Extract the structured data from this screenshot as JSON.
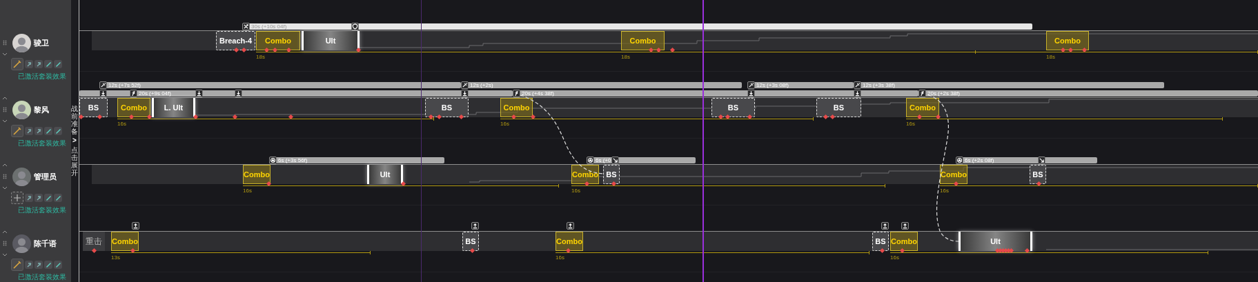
{
  "side_labels": [
    {
      "kind": "label",
      "text": "战前准备"
    },
    {
      "kind": "toggle",
      "text": ">"
    },
    {
      "kind": "label",
      "text": "点击展开"
    }
  ],
  "operators": [
    {
      "name": "骏卫",
      "can_move_up": false,
      "weapon_equipped": true,
      "set_bonus": "已激活套装效果",
      "buffs": [
        {
          "kind": "swords",
          "text": "30s (+10s 04f)",
          "color": "#e6e6e6"
        },
        {
          "kind": "shield"
        }
      ],
      "skills": [
        {
          "kind": "bs",
          "label": "Breach-4"
        },
        {
          "kind": "combo",
          "label": "Combo"
        },
        {
          "kind": "ult",
          "label": "Ult"
        },
        {
          "kind": "combo",
          "label": "Combo"
        },
        {
          "kind": "combo",
          "label": "Combo"
        }
      ],
      "cooldowns": [
        {
          "label": "18s"
        },
        {
          "label": "18s"
        },
        {
          "label": "18s"
        }
      ]
    },
    {
      "name": "黎风",
      "can_move_up": true,
      "weapon_equipped": true,
      "set_bonus": "已激活套装效果",
      "buffs": [
        {
          "kind": "burst",
          "text": "12s (+7s 52f)",
          "color": "#a9a9a9"
        },
        {
          "kind": "drop"
        },
        {
          "kind": "feather",
          "text": "20s (+9s 04f)",
          "color": "#a9a9a9"
        },
        {
          "kind": "drop"
        },
        {
          "kind": "drop"
        },
        {
          "kind": "burst",
          "text": "12s (+2s)",
          "color": "#a9a9a9"
        },
        {
          "kind": "drop"
        },
        {
          "kind": "feather",
          "text": "20s (+4s 38f)",
          "color": "#a9a9a9"
        },
        {
          "kind": "burst",
          "text": "12s (+3s 08f)",
          "color": "#a9a9a9"
        },
        {
          "kind": "drop"
        },
        {
          "kind": "burst",
          "text": "12s (+3s 38f)",
          "color": "#a9a9a9"
        },
        {
          "kind": "drop"
        },
        {
          "kind": "feather",
          "text": "20s (+2s 38f)",
          "color": "#a9a9a9"
        }
      ],
      "skills": [
        {
          "kind": "bs",
          "label": "BS"
        },
        {
          "kind": "combo",
          "label": "Combo"
        },
        {
          "kind": "ult",
          "label": "L. Ult"
        },
        {
          "kind": "bs",
          "label": "BS"
        },
        {
          "kind": "combo",
          "label": "Combo"
        },
        {
          "kind": "bs",
          "label": "BS"
        },
        {
          "kind": "bs",
          "label": "BS"
        },
        {
          "kind": "combo",
          "label": "Combo"
        }
      ],
      "cooldowns": [
        {
          "label": "16s"
        },
        {
          "label": "16s"
        },
        {
          "label": "16s"
        }
      ]
    },
    {
      "name": "管理员",
      "can_move_up": true,
      "weapon_equipped": false,
      "set_bonus": "已激活套装效果",
      "buffs": [
        {
          "kind": "cycle",
          "text": "6s (+3s 56f)",
          "color": "#a9a9a9"
        },
        {
          "kind": "cycle",
          "text": "6s (+0",
          "color": "#a9a9a9"
        },
        {
          "kind": "arrow"
        },
        {
          "kind": "cycle",
          "text": "6s (+2s 08f)",
          "color": "#a9a9a9"
        },
        {
          "kind": "arrow"
        }
      ],
      "skills": [
        {
          "kind": "combo",
          "label": "Combo"
        },
        {
          "kind": "ult",
          "label": "Ult"
        },
        {
          "kind": "combo",
          "label": "Combo"
        },
        {
          "kind": "bs",
          "label": "BS"
        },
        {
          "kind": "combo",
          "label": "Combo"
        },
        {
          "kind": "bs",
          "label": "BS"
        }
      ],
      "cooldowns": [
        {
          "label": "16s"
        },
        {
          "label": "16s"
        },
        {
          "label": "16s"
        }
      ]
    },
    {
      "name": "陈千语",
      "can_move_up": true,
      "weapon_equipped": true,
      "set_bonus": "已激活套装效果",
      "buffs": [
        {
          "kind": "rise"
        },
        {
          "kind": "rise"
        },
        {
          "kind": "rise"
        },
        {
          "kind": "rise"
        },
        {
          "kind": "rise"
        }
      ],
      "skills": [
        {
          "kind": "heavy",
          "label": "重击"
        },
        {
          "kind": "combo",
          "label": "Combo"
        },
        {
          "kind": "bs",
          "label": "BS"
        },
        {
          "kind": "combo",
          "label": "Combo"
        },
        {
          "kind": "bs",
          "label": "BS"
        },
        {
          "kind": "combo",
          "label": "Combo"
        },
        {
          "kind": "ult",
          "label": "Ult"
        }
      ],
      "cooldowns": [
        {
          "label": "13s"
        },
        {
          "label": "16s"
        },
        {
          "label": "16s"
        }
      ]
    }
  ]
}
